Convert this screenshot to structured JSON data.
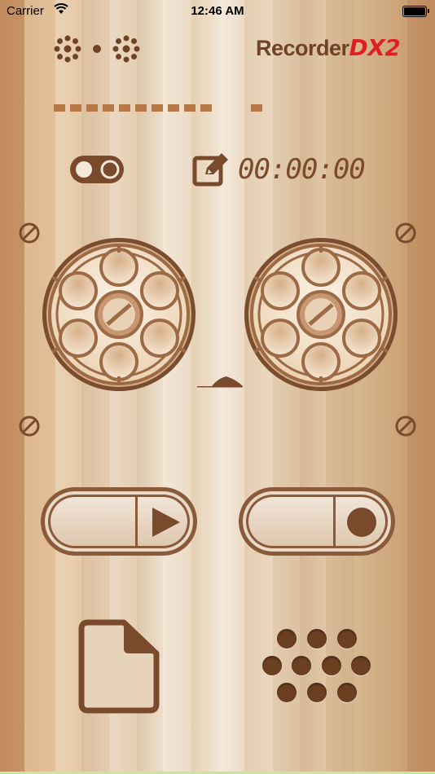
{
  "status_bar": {
    "carrier": "Carrier",
    "time": "12:46 AM"
  },
  "brand": {
    "name": "Recorder",
    "suffix": "DX2"
  },
  "timer": {
    "display": "00:00:00"
  },
  "level_meter": {
    "active_segments": 10,
    "total_segments": 11
  },
  "icons": {
    "activity": "sparkle-dot-sparkle-icon",
    "toggle": "toggle-icon",
    "edit": "edit-note-icon",
    "play": "play-icon",
    "record": "record-icon",
    "file": "document-icon",
    "keypad": "keypad-icon"
  },
  "colors": {
    "accent": "#7a4a2c",
    "brand_red": "#e02020",
    "meter": "#b67847"
  }
}
